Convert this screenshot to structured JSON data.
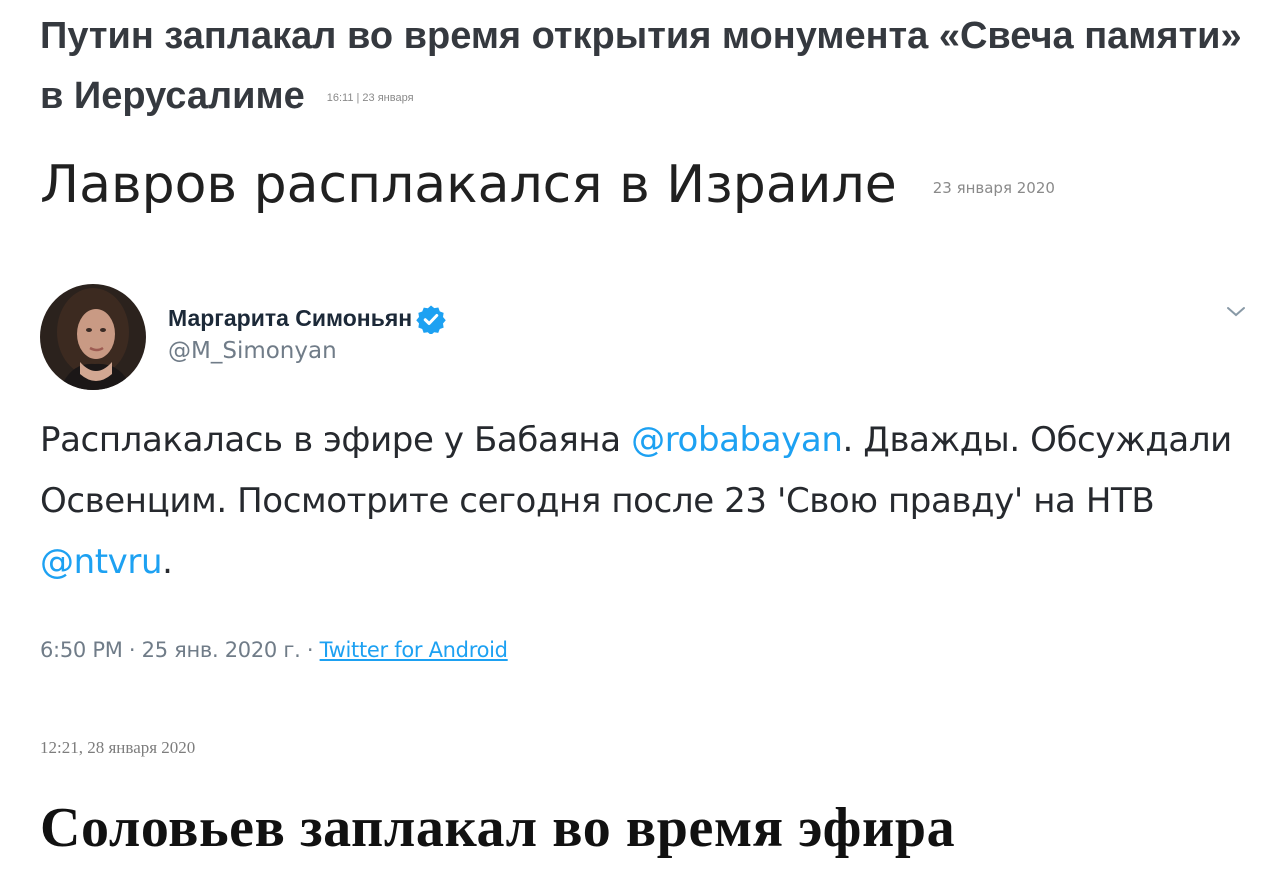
{
  "story1": {
    "title": "Путин заплакал во время открытия монумента «Свеча памяти» в Иерусалиме",
    "meta": "16:11 | 23 января"
  },
  "story2": {
    "title": "Лавров расплакался в Израиле",
    "date": "23 января 2020"
  },
  "tweet": {
    "author_name": "Маргарита Симоньян",
    "handle": "@M_Simonyan",
    "verified_icon": "verified-badge-icon",
    "more_icon": "chevron-down-icon",
    "text_part1": "Расплакалась в эфире у Бабаяна ",
    "mention1": "@robabayan",
    "text_part2": ". Дважды. Обсуждали Освенцим. Посмотрите сегодня после 23 'Свою правду' на НТВ ",
    "mention2": "@ntvru",
    "text_part3": ".",
    "time": "6:50 PM · 25 янв. 2020 г. · ",
    "source": "Twitter for Android",
    "colors": {
      "link": "#1da1f2",
      "secondary": "#707c88"
    }
  },
  "story3": {
    "timestamp": "12:21, 28 января 2020",
    "title": "Соловьев заплакал во время эфира"
  }
}
